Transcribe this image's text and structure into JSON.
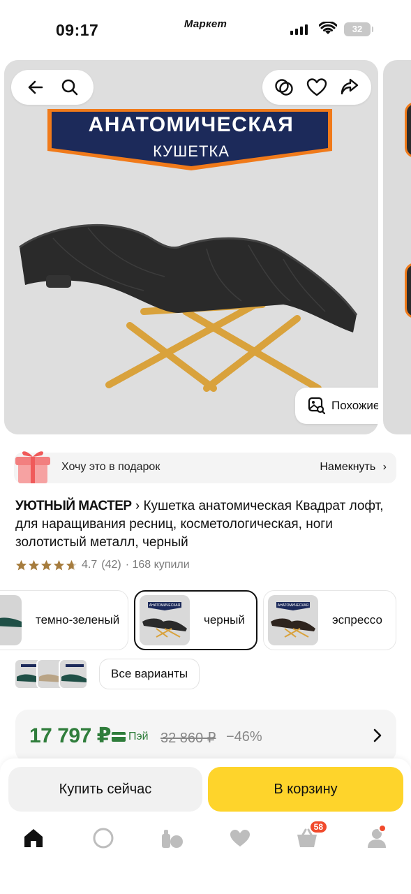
{
  "status_bar": {
    "time": "09:17",
    "brand": "Маркет",
    "battery": "32"
  },
  "gallery": {
    "banner_line1": "АНАТОМИЧЕСКАЯ",
    "banner_line2": "КУШЕТКА",
    "similar_label": "Похожие"
  },
  "gift": {
    "text": "Хочу это в подарок",
    "hint": "Намекнуть"
  },
  "product": {
    "brand": "УЮТНЫЙ МАСТЕР",
    "title": "Кушетка анатомическая Квадрат лофт, для наращивания ресниц, косметологическая, ноги золотистый металл, черный",
    "rating": "4.7",
    "reviews": "(42)",
    "bought": "· 168 купили",
    "stars_value": 4.7
  },
  "variants": [
    {
      "label": "темно-зеленый",
      "selected": false
    },
    {
      "label": "черный",
      "selected": true
    },
    {
      "label": "эспрессо",
      "selected": false
    }
  ],
  "variant_thumb_label": "АНАТОМИЧЕСКАЯ",
  "all_variants_label": "Все варианты",
  "price": {
    "current": "17 797 ₽",
    "pay_label": "Пэй",
    "old": "32 860 ₽",
    "discount": "−46%"
  },
  "actions": {
    "buy_now": "Купить сейчас",
    "to_cart": "В корзину"
  },
  "tabbar": {
    "cart_badge": "58"
  },
  "colors": {
    "accent_yellow": "#fed42b",
    "price_green": "#2f7d3b",
    "badge_red": "#f14a2c"
  }
}
